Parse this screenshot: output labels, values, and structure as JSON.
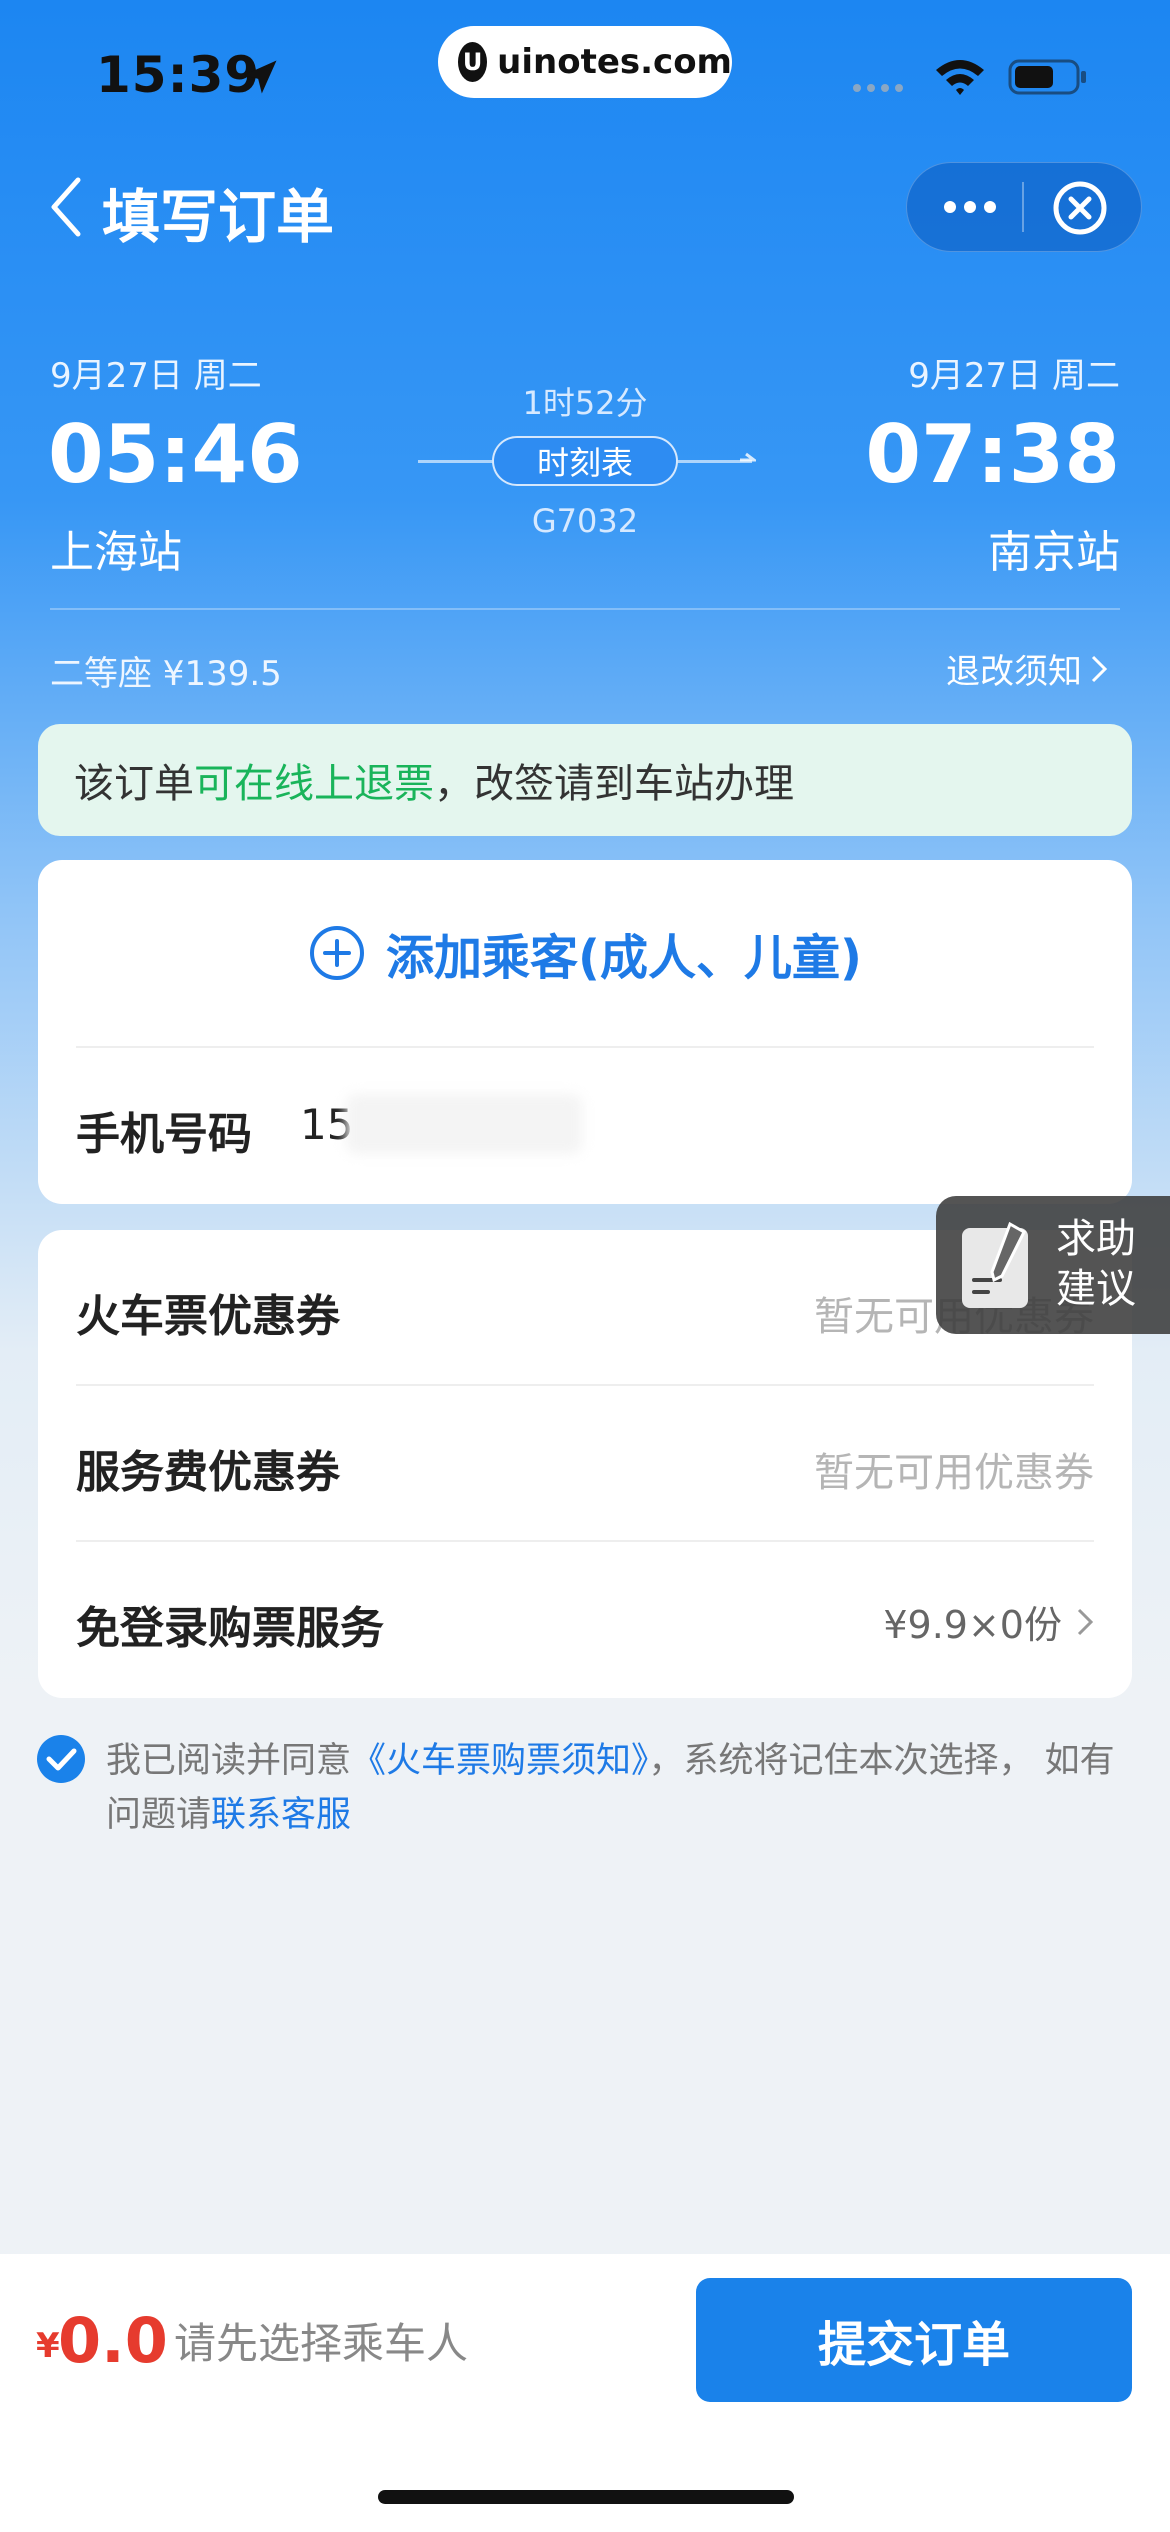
{
  "status_bar": {
    "time": "15:39",
    "brand_logo_letter": "U",
    "brand": "uinotes.com"
  },
  "nav": {
    "title": "填写订单"
  },
  "train": {
    "dep_date": "9月27日 周二",
    "dep_time": "05:46",
    "dep_station": "上海站",
    "arr_date": "9月27日 周二",
    "arr_time": "07:38",
    "arr_station": "南京站",
    "duration": "1时52分",
    "timetable_label": "时刻表",
    "train_no": "G7032",
    "seat_info": "二等座 ¥139.5",
    "refund_label": "退改须知"
  },
  "banner": {
    "prefix": "该订单",
    "highlight": "可在线上退票",
    "suffix": "，改签请到车站办理"
  },
  "passenger": {
    "add_label": "添加乘客(成人、儿童)",
    "phone_label": "手机号码",
    "phone_value": "15"
  },
  "coupons": {
    "train_label": "火车票优惠券",
    "train_value": "暂无可用优惠券",
    "service_label": "服务费优惠券",
    "service_value": "暂无可用优惠券",
    "login_free_label": "免登录购票服务",
    "login_free_value": "¥9.9×0份"
  },
  "help": {
    "line1": "求助",
    "line2": "建议"
  },
  "agreement": {
    "prefix": "我已阅读并同意",
    "link": "《火车票购票须知》",
    "middle": "，系统将记住本次选择， 如有问题请",
    "service_link": "联系客服"
  },
  "bottom": {
    "currency": "¥",
    "price": "0.0",
    "hint": "请先选择乘车人",
    "submit": "提交订单"
  },
  "colors": {
    "primary": "#1a82ea",
    "green": "#19b45a",
    "price_red": "#e63b2e"
  }
}
